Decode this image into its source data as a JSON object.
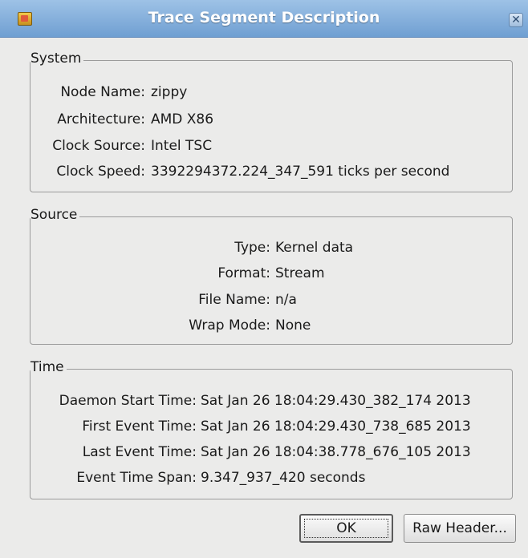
{
  "window": {
    "title": "Trace Segment Description"
  },
  "system": {
    "title": "System",
    "rows": [
      {
        "label": "Node Name:",
        "value": "zippy"
      },
      {
        "label": "Architecture:",
        "value": "AMD X86"
      },
      {
        "label": "Clock Source:",
        "value": "Intel TSC"
      },
      {
        "label": "Clock Speed:",
        "value": "3392294372.224_347_591 ticks per second"
      }
    ]
  },
  "source": {
    "title": "Source",
    "rows": [
      {
        "label": "Type:",
        "value": "Kernel data"
      },
      {
        "label": "Format:",
        "value": "Stream"
      },
      {
        "label": "File Name:",
        "value": "n/a"
      },
      {
        "label": "Wrap Mode:",
        "value": "None"
      }
    ]
  },
  "time": {
    "title": "Time",
    "rows": [
      {
        "label": "Daemon Start Time:",
        "value": "Sat Jan 26 18:04:29.430_382_174 2013"
      },
      {
        "label": "First Event Time:",
        "value": "Sat Jan 26 18:04:29.430_738_685 2013"
      },
      {
        "label": "Last Event Time:",
        "value": "Sat Jan 26 18:04:38.778_676_105 2013"
      },
      {
        "label": "Event Time Span:",
        "value": "9.347_937_420 seconds"
      }
    ]
  },
  "buttons": {
    "ok": "OK",
    "raw_header": "Raw Header..."
  }
}
